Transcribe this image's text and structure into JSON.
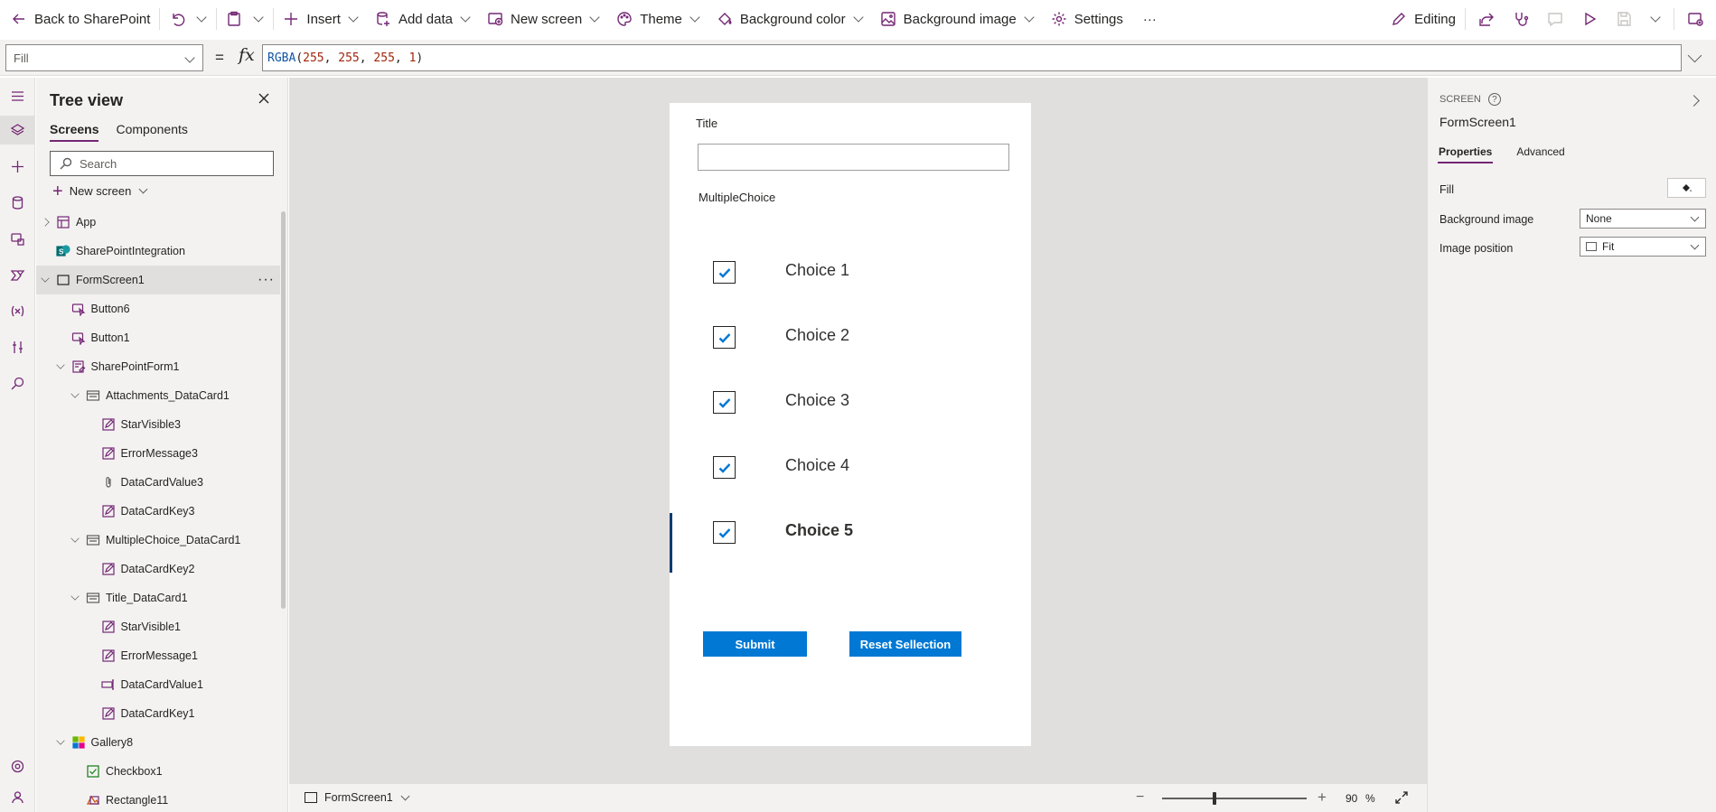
{
  "topbar": {
    "back_label": "Back to SharePoint",
    "insert_label": "Insert",
    "add_data_label": "Add data",
    "new_screen_label": "New screen",
    "theme_label": "Theme",
    "bg_color_label": "Background color",
    "bg_image_label": "Background image",
    "settings_label": "Settings",
    "more_label": "···",
    "editing_label": "Editing"
  },
  "formula": {
    "property": "Fill",
    "fn": "RGBA",
    "open": "(",
    "args": [
      "255",
      "255",
      "255",
      "1"
    ],
    "sep": ", ",
    "close": ")",
    "equals": "=",
    "fx": "fx"
  },
  "tree": {
    "title": "Tree view",
    "tabs": [
      "Screens",
      "Components"
    ],
    "search_placeholder": "Search",
    "new_screen_label": "New screen",
    "items": [
      {
        "label": "App",
        "icon": "app-icon",
        "level": 0,
        "expander": "right",
        "selected": false
      },
      {
        "label": "SharePointIntegration",
        "icon": "sharepoint-icon",
        "level": 0,
        "expander": "",
        "selected": false
      },
      {
        "label": "FormScreen1",
        "icon": "screen-icon",
        "level": 0,
        "expander": "down",
        "selected": true
      },
      {
        "label": "Button6",
        "icon": "button-icon",
        "level": 1,
        "expander": "",
        "selected": false
      },
      {
        "label": "Button1",
        "icon": "button-icon",
        "level": 1,
        "expander": "",
        "selected": false
      },
      {
        "label": "SharePointForm1",
        "icon": "form-icon",
        "level": 1,
        "expander": "down",
        "selected": false
      },
      {
        "label": "Attachments_DataCard1",
        "icon": "datacard-icon",
        "level": 2,
        "expander": "down",
        "selected": false
      },
      {
        "label": "StarVisible3",
        "icon": "edit-icon",
        "level": 3,
        "expander": "",
        "selected": false
      },
      {
        "label": "ErrorMessage3",
        "icon": "edit-icon",
        "level": 3,
        "expander": "",
        "selected": false
      },
      {
        "label": "DataCardValue3",
        "icon": "attachment-icon",
        "level": 3,
        "expander": "",
        "selected": false
      },
      {
        "label": "DataCardKey3",
        "icon": "edit-icon",
        "level": 3,
        "expander": "",
        "selected": false
      },
      {
        "label": "MultipleChoice_DataCard1",
        "icon": "datacard-icon",
        "level": 2,
        "expander": "down",
        "selected": false
      },
      {
        "label": "DataCardKey2",
        "icon": "edit-icon",
        "level": 3,
        "expander": "",
        "selected": false
      },
      {
        "label": "Title_DataCard1",
        "icon": "datacard-icon",
        "level": 2,
        "expander": "down",
        "selected": false
      },
      {
        "label": "StarVisible1",
        "icon": "edit-icon",
        "level": 3,
        "expander": "",
        "selected": false
      },
      {
        "label": "ErrorMessage1",
        "icon": "edit-icon",
        "level": 3,
        "expander": "",
        "selected": false
      },
      {
        "label": "DataCardValue1",
        "icon": "textinput-icon",
        "level": 3,
        "expander": "",
        "selected": false
      },
      {
        "label": "DataCardKey1",
        "icon": "edit-icon",
        "level": 3,
        "expander": "",
        "selected": false
      },
      {
        "label": "Gallery8",
        "icon": "gallery-icon",
        "level": 1,
        "expander": "down",
        "selected": false
      },
      {
        "label": "Checkbox1",
        "icon": "checkbox-icon",
        "level": 2,
        "expander": "",
        "selected": false
      },
      {
        "label": "Rectangle11",
        "icon": "rectangle-icon",
        "level": 2,
        "expander": "",
        "selected": false
      }
    ]
  },
  "canvas": {
    "title_label": "Title",
    "title_value": "",
    "multi_label": "MultipleChoice",
    "choices": [
      {
        "label": "Choice 1",
        "checked": true,
        "bold": false
      },
      {
        "label": "Choice 2",
        "checked": true,
        "bold": false
      },
      {
        "label": "Choice 3",
        "checked": true,
        "bold": false
      },
      {
        "label": "Choice 4",
        "checked": true,
        "bold": false
      },
      {
        "label": "Choice 5",
        "checked": true,
        "bold": true
      }
    ],
    "submit_label": "Submit",
    "reset_label": "Reset Sellection"
  },
  "status": {
    "screen_name": "FormScreen1",
    "zoom_value": "90",
    "zoom_unit": "%",
    "zoom_level": 0.35
  },
  "props": {
    "type_label": "SCREEN",
    "help": "?",
    "name": "FormScreen1",
    "tabs": [
      "Properties",
      "Advanced"
    ],
    "fill_label": "Fill",
    "fill_color": "#ffffff",
    "bg_image_label": "Background image",
    "bg_image_value": "None",
    "image_position_label": "Image position",
    "image_position_value": "Fit"
  },
  "colors": {
    "accent": "#742774",
    "button": "#0078d4",
    "canvas_bg": "#e1dfdd"
  }
}
